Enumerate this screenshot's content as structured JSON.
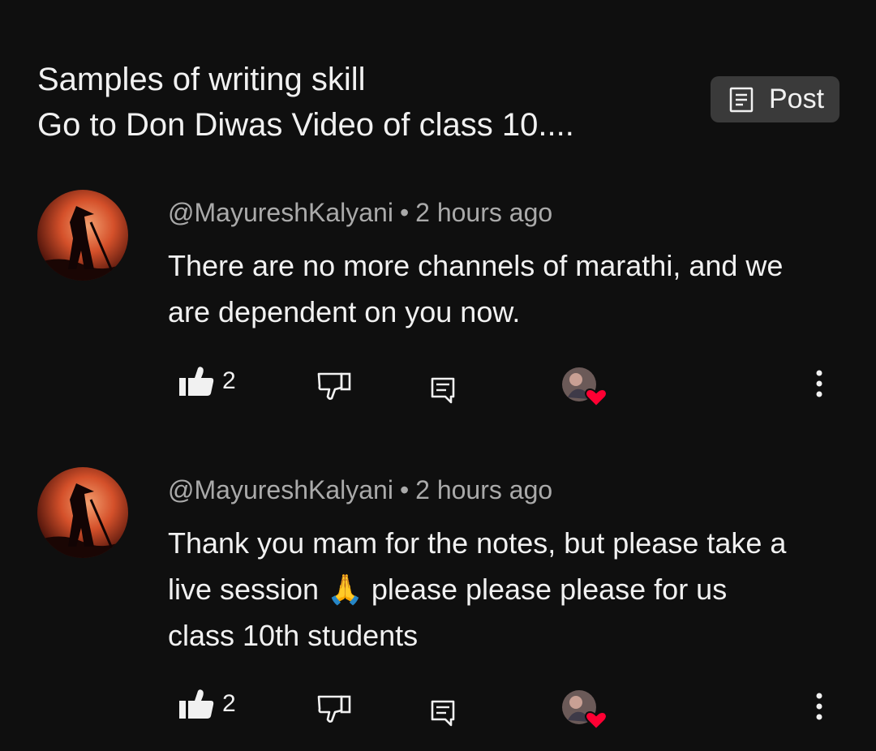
{
  "header": {
    "title_line1": "Samples of writing skill",
    "title_line2": "Go to Don Diwas Video of class 10....",
    "post_button_label": "Post"
  },
  "comments": [
    {
      "author": "@MayureshKalyani",
      "separator": "•",
      "time": "2 hours ago",
      "lines": [
        "There are no more channels of marathi, and we",
        "are dependent on you now."
      ],
      "likes": "2"
    },
    {
      "author": "@MayureshKalyani",
      "separator": "•",
      "time": "2 hours ago",
      "lines": [
        "Thank you mam for the notes, but please take a",
        "live session 🙏 please please please for us",
        "class 10th students"
      ],
      "likes": "2"
    }
  ],
  "icons": {
    "post": "document-lines-icon",
    "like": "thumbs-up-icon",
    "dislike": "thumbs-down-icon",
    "reply": "reply-comment-icon",
    "creator_heart": "creator-heart-icon",
    "more": "more-vertical-icon"
  },
  "colors": {
    "background": "#0f0f0f",
    "chip": "#3a3a3a",
    "heart": "#ff0033",
    "secondary_text": "#aaaaaa"
  }
}
